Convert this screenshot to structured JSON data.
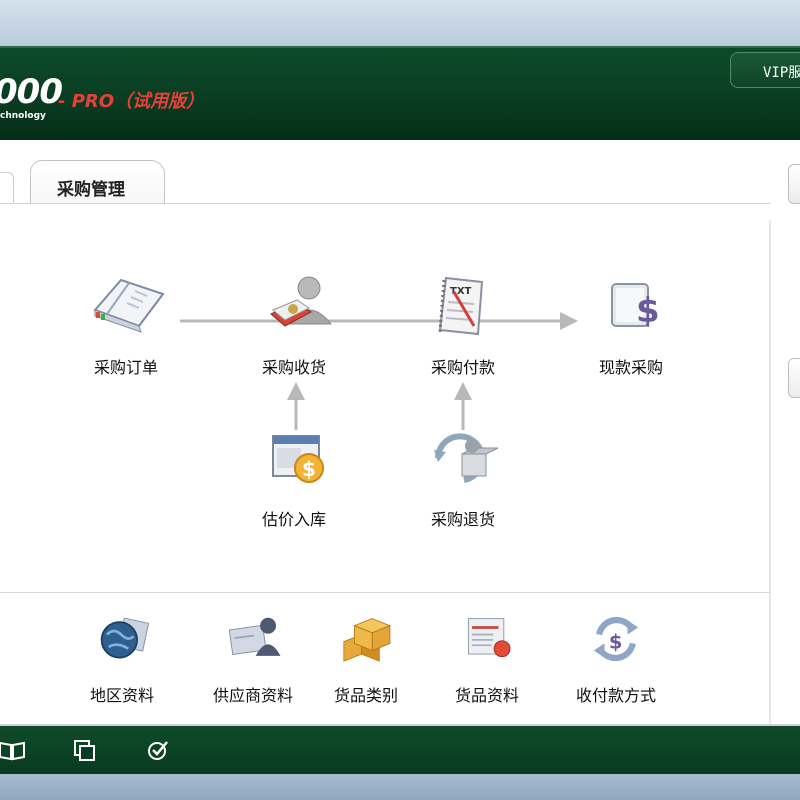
{
  "header": {
    "logo_number": "000",
    "logo_edition": "- PRO（试用版）",
    "logo_tagline": "chnology",
    "vip_label": "VIP服"
  },
  "tabs": {
    "active": "采购管理"
  },
  "flow": {
    "purchase_order": "采购订单",
    "purchase_receipt": "采购收货",
    "purchase_payment": "采购付款",
    "cash_purchase": "现款采购",
    "estimated_stock_in": "估价入库",
    "purchase_return": "采购退货"
  },
  "basics": {
    "region_data": "地区资料",
    "supplier_data": "供应商资料",
    "goods_category": "货品类别",
    "goods_data": "货品资料",
    "payment_method": "收付款方式"
  },
  "footer": {
    "icons": [
      "book-icon",
      "copy-icon",
      "check-icon"
    ]
  },
  "colors": {
    "header_green": "#0a3d22",
    "logo_red": "#e5413a",
    "arrow_gray": "#b8b8b8"
  }
}
